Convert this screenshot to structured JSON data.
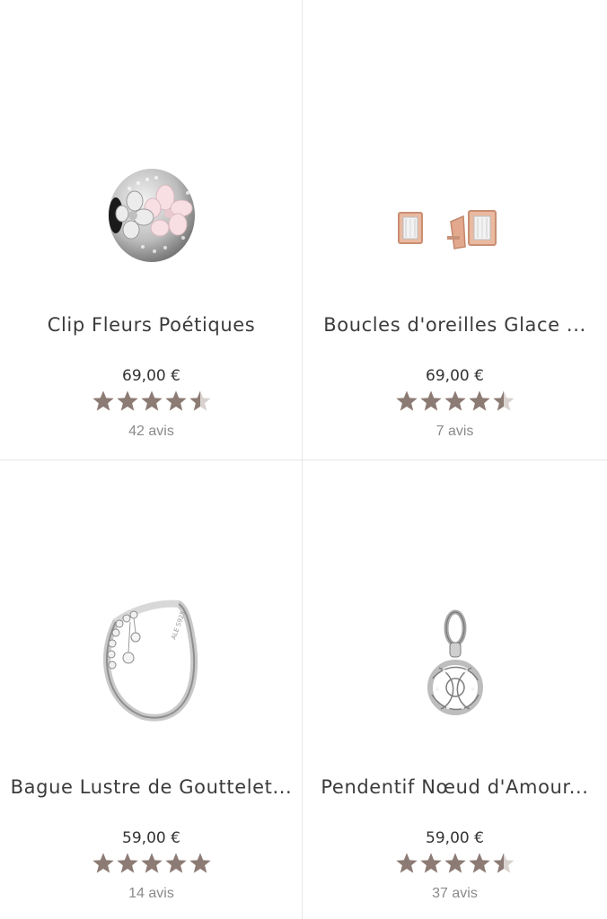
{
  "products": [
    {
      "name": "Clip Fleurs Poétiques",
      "price": "69,00 €",
      "rating": 4.5,
      "reviews": "42 avis",
      "image_icon": "flower-clip-charm-icon"
    },
    {
      "name": "Boucles d'oreilles Glace ...",
      "price": "69,00 €",
      "rating": 4.5,
      "reviews": "7 avis",
      "image_icon": "stud-earrings-icon"
    },
    {
      "name": "Bague Lustre de Gouttelet...",
      "price": "59,00 €",
      "rating": 5,
      "reviews": "14 avis",
      "image_icon": "droplet-ring-icon"
    },
    {
      "name": "Pendentif Nœud d'Amour...",
      "price": "59,00 €",
      "rating": 4.5,
      "reviews": "37 avis",
      "image_icon": "love-knot-pendant-icon"
    }
  ],
  "colors": {
    "star": "#8c7b74",
    "star_empty": "#d9d2cf",
    "divider": "#e6e6e6",
    "text": "#3b3b3b",
    "muted": "#8a8a8a"
  }
}
